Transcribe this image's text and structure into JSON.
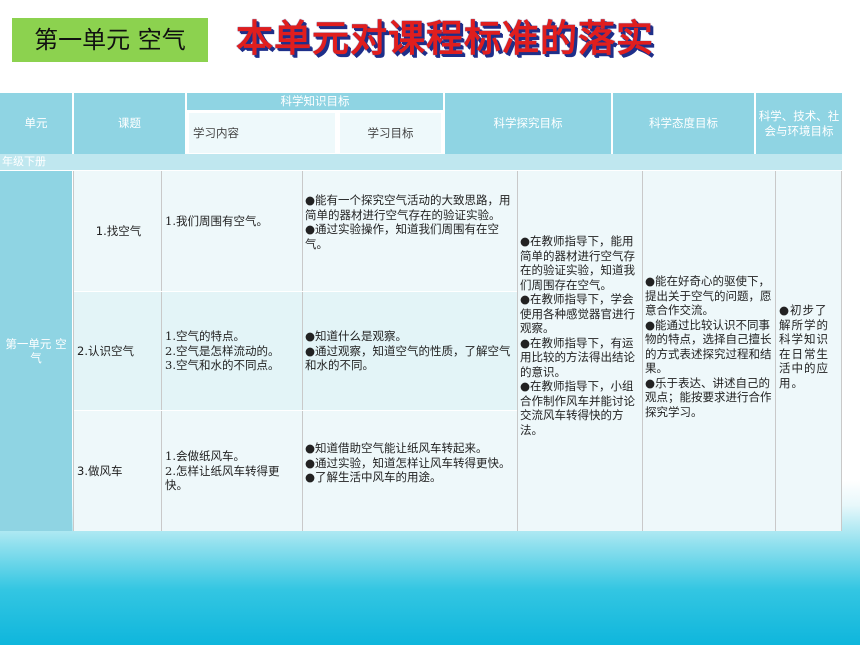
{
  "header": {
    "badge": "第一单元 空气",
    "title": "本单元对课程标准的落实"
  },
  "table": {
    "columns": {
      "unit": "单元",
      "lesson": "课题",
      "knowledge": "科学知识目标",
      "learning_content": "学习内容",
      "learning_goal": "学习目标",
      "inquiry": "科学探究目标",
      "attitude": "科学态度目标",
      "sts": "科学、技术、社会与环境目标"
    },
    "grade_label": "年级下册",
    "unit_name": "第一单元 空气",
    "rows": [
      {
        "lesson": "1.找空气",
        "content": [
          "1.我们周围有空气。"
        ],
        "goals": [
          "●能有一个探究空气活动的大致思路，用简单的器材进行空气存在的验证实验。",
          "●通过实验操作，知道我们周围有在空气。"
        ]
      },
      {
        "lesson": "2.认识空气",
        "content": [
          "1.空气的特点。",
          "2.空气是怎样流动的。",
          "3.空气和水的不同点。"
        ],
        "goals": [
          "●知道什么是观察。",
          "●通过观察，知道空气的性质，了解空气和水的不同。"
        ]
      },
      {
        "lesson": "3.做风车",
        "content": [
          "1.会做纸风车。",
          "2.怎样让纸风车转得更快。"
        ],
        "goals": [
          "●知道借助空气能让纸风车转起来。",
          "●通过实验，知道怎样让风车转得更快。",
          "●了解生活中风车的用途。"
        ]
      }
    ],
    "inquiry_text": [
      "●在教师指导下，能用简单的器材进行空气存在的验证实验，知道我们周围存在空气。",
      "●在教师指导下，学会使用各种感觉器官进行观察。",
      "●在教师指导下，有运用比较的方法得出结论的意识。",
      "●在教师指导下，小组合作制作风车并能讨论交流风车转得快的方法。"
    ],
    "attitude_text": [
      "●能在好奇心的驱使下，提出关于空气的问题，愿意合作交流。",
      "●能通过比较认识不同事物的特点，选择自己擅长的方式表述探究过程和结果。",
      "●乐于表达、讲述自己的观点；能按要求进行合作探究学习。"
    ],
    "sts_text": [
      "●初步了解所学的科学知识在日常生活中的应用。"
    ]
  }
}
